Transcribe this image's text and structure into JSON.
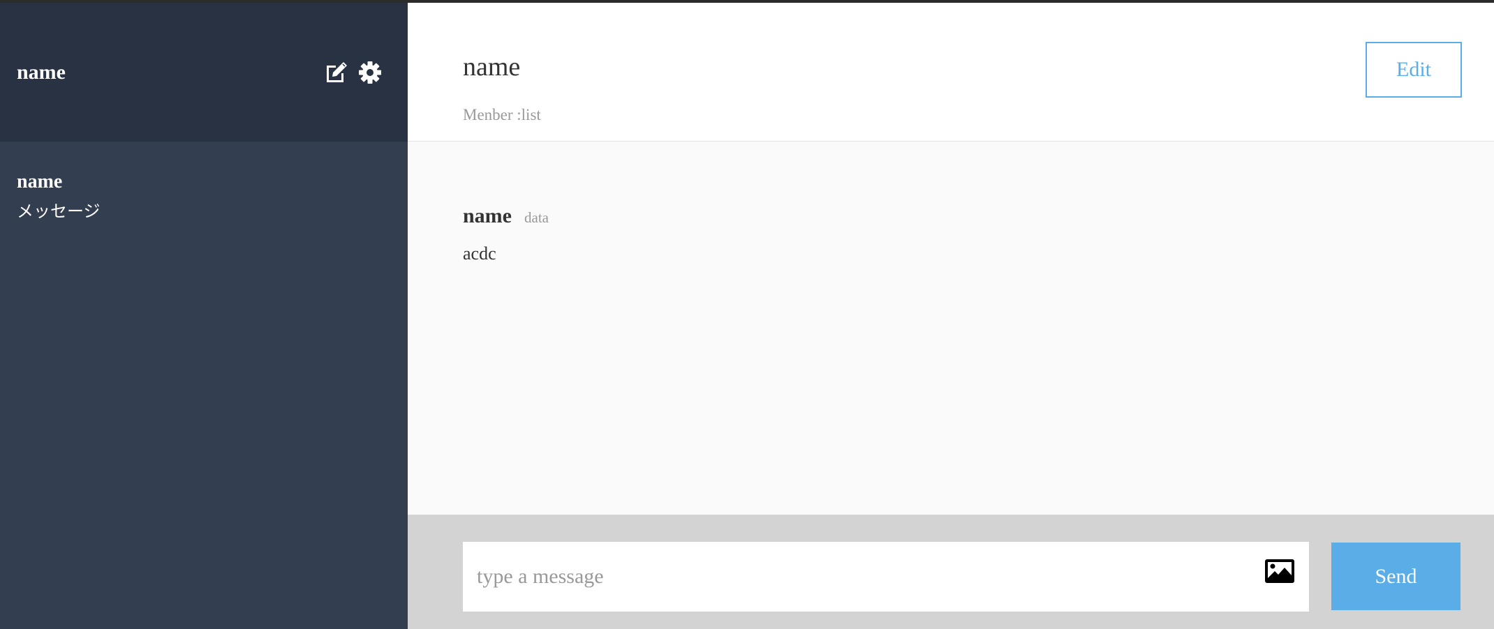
{
  "sidebar": {
    "header": {
      "user_name": "name",
      "edit_icon": "edit-icon",
      "settings_icon": "gear-icon"
    },
    "groups": [
      {
        "name": "name",
        "last_message": "メッセージ"
      }
    ]
  },
  "main": {
    "header": {
      "group_name": "name",
      "member_list": "Menber :list",
      "edit_label": "Edit"
    },
    "messages": [
      {
        "user": "name",
        "date": "data",
        "text": "acdc"
      }
    ],
    "form": {
      "placeholder": "type a message",
      "image_icon": "image-icon",
      "send_label": "Send"
    }
  },
  "colors": {
    "sidebar_header_bg": "#283242",
    "sidebar_bg": "#333e50",
    "accent": "#5bade8",
    "form_bg": "#d3d3d3"
  }
}
